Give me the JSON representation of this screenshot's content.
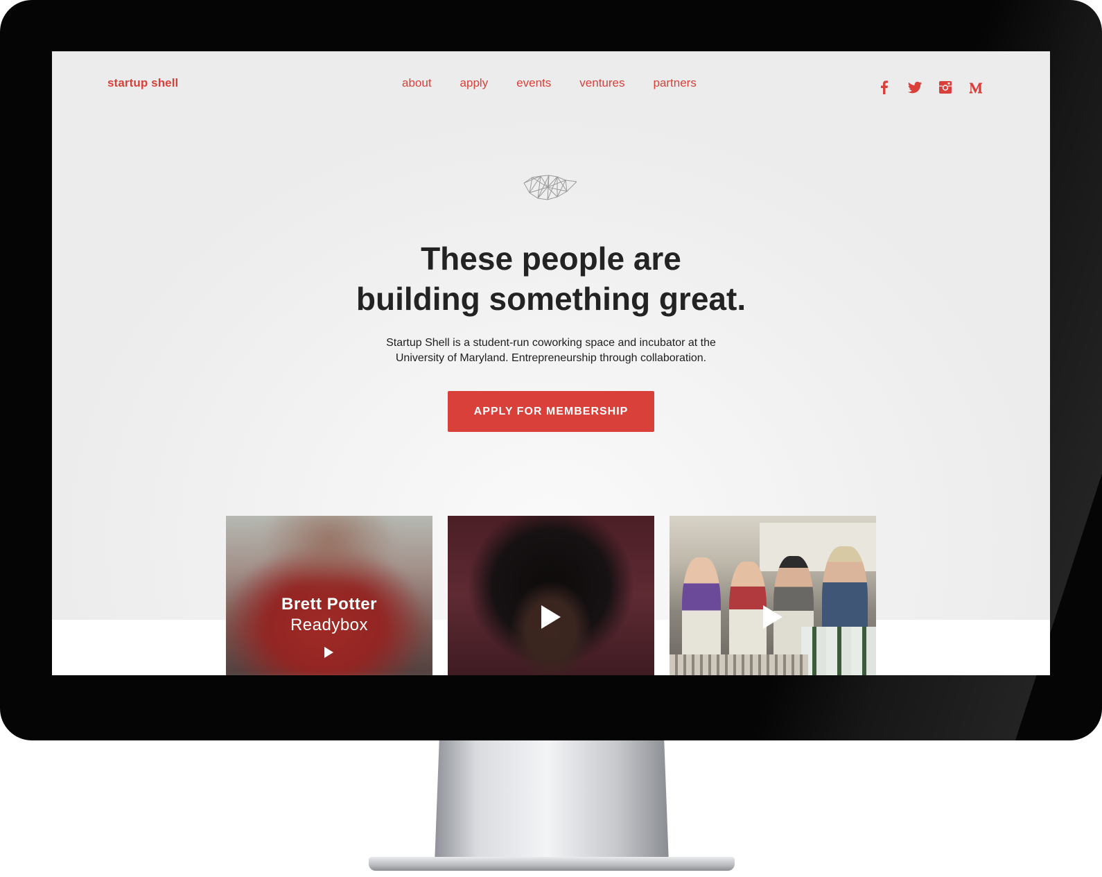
{
  "nav": {
    "logo": "startup shell",
    "links": [
      "about",
      "apply",
      "events",
      "ventures",
      "partners"
    ],
    "social_icons": [
      "facebook-icon",
      "twitter-icon",
      "instagram-icon",
      "medium-icon"
    ]
  },
  "hero": {
    "logo_icon": "geometric-shell-logo",
    "title_line1": "These people are",
    "title_line2": "building something great.",
    "subtitle_line1": "Startup Shell is a student-run coworking space and incubator at the",
    "subtitle_line2": "University of Maryland. Entrepreneurship through collaboration.",
    "cta_label": "APPLY FOR MEMBERSHIP"
  },
  "videos": [
    {
      "name": "Brett Potter",
      "company": "Readybox",
      "icon": "play-icon"
    },
    {
      "icon": "play-icon"
    },
    {
      "icon": "play-icon"
    }
  ],
  "colors": {
    "accent": "#d9403a",
    "heading": "#232323",
    "background": "#efefef"
  }
}
